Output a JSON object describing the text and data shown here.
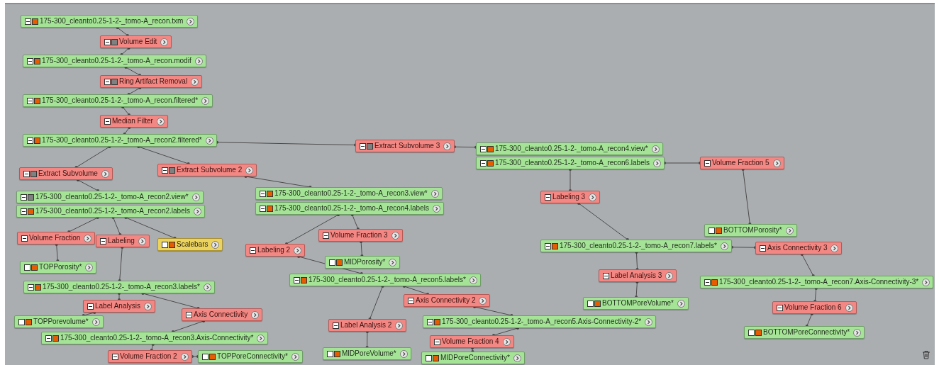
{
  "nodes": [
    {
      "kind": "data",
      "label": "175-300_cleanto0.25-1-2-_tomo-A_recon.txm",
      "expander": true,
      "color": "#e65c00"
    },
    {
      "kind": "module",
      "label": "Volume Edit",
      "expander": true,
      "color": "#808080"
    },
    {
      "kind": "data",
      "label": "175-300_cleanto0.25-1-2-_tomo-A_recon.modif",
      "expander": true,
      "color": "#e65c00"
    },
    {
      "kind": "module",
      "label": "Ring Artifact Removal",
      "expander": true,
      "color": "#808080"
    },
    {
      "kind": "data",
      "label": "175-300_cleanto0.25-1-2-_tomo-A_recon.filtered*",
      "expander": true,
      "color": "#e65c00"
    },
    {
      "kind": "module",
      "label": "Median Filter",
      "expander": true
    },
    {
      "kind": "data",
      "label": "175-300_cleanto0.25-1-2-_tomo-A_recon2.filtered*",
      "expander": true,
      "color": "#e65c00"
    },
    {
      "kind": "module",
      "label": "Extract Subvolume",
      "expander": true,
      "color": "#808080"
    },
    {
      "kind": "module",
      "label": "Extract Subvolume 2",
      "expander": true,
      "color": "#808080"
    },
    {
      "kind": "module",
      "label": "Extract Subvolume 3",
      "expander": true,
      "color": "#808080"
    },
    {
      "kind": "data",
      "label": "175-300_cleanto0.25-1-2-_tomo-A_recon4.view*",
      "expander": true,
      "color": "#e65c00"
    },
    {
      "kind": "data",
      "label": "175-300_cleanto0.25-1-2-_tomo-A_recon6.labels",
      "expander": true,
      "color": "#e65c00"
    },
    {
      "kind": "module",
      "label": "Volume Fraction 5",
      "expander": true
    },
    {
      "kind": "data",
      "label": "175-300_cleanto0.25-1-2-_tomo-A_recon2.view*",
      "expander": true,
      "color": "#808080"
    },
    {
      "kind": "data",
      "label": "175-300_cleanto0.25-1-2-_tomo-A_recon2.labels",
      "expander": true,
      "color": "#e65c00"
    },
    {
      "kind": "module",
      "label": "Labeling 3",
      "expander": true
    },
    {
      "kind": "data",
      "label": "175-300_cleanto0.25-1-2-_tomo-A_recon3.view*",
      "expander": true,
      "color": "#e65c00"
    },
    {
      "kind": "data",
      "label": "175-300_cleanto0.25-1-2-_tomo-A_recon4.labels",
      "expander": true,
      "color": "#e65c00"
    },
    {
      "kind": "module",
      "label": "Volume Fraction",
      "expander": true
    },
    {
      "kind": "module",
      "label": "Labeling",
      "expander": true
    },
    {
      "kind": "display",
      "label": "Scalebars",
      "expander": false,
      "color": "#e65c00"
    },
    {
      "kind": "module",
      "label": "Volume Fraction 3",
      "expander": true
    },
    {
      "kind": "data",
      "label": "BOTTOMPorosity*",
      "expander": false,
      "color": "#e65c00"
    },
    {
      "kind": "module",
      "label": "Labeling 2",
      "expander": true
    },
    {
      "kind": "data",
      "label": "175-300_cleanto0.25-1-2-_tomo-A_recon7.labels*",
      "expander": true,
      "color": "#e65c00"
    },
    {
      "kind": "module",
      "label": "Axis Connectivity 3",
      "expander": true
    },
    {
      "kind": "data",
      "label": "TOPPorosity*",
      "expander": false,
      "color": "#e65c00"
    },
    {
      "kind": "data",
      "label": "MIDPorosity*",
      "expander": false,
      "color": "#e65c00"
    },
    {
      "kind": "module",
      "label": "Label Analysis 3",
      "expander": true
    },
    {
      "kind": "data",
      "label": "175-300_cleanto0.25-1-2-_tomo-A_recon5.labels*",
      "expander": true,
      "color": "#e65c00"
    },
    {
      "kind": "data",
      "label": "175-300_cleanto0.25-1-2-_tomo-A_recon7.Axis-Connectivity-3*",
      "expander": true,
      "color": "#e65c00"
    },
    {
      "kind": "data",
      "label": "175-300_cleanto0.25-1-2-_tomo-A_recon3.labels*",
      "expander": true,
      "color": "#e65c00"
    },
    {
      "kind": "module",
      "label": "Axis Connectivity 2",
      "expander": true
    },
    {
      "kind": "module",
      "label": "Label Analysis",
      "expander": true
    },
    {
      "kind": "data",
      "label": "BOTTOMPoreVolume*",
      "expander": false,
      "color": "#e65c00"
    },
    {
      "kind": "module",
      "label": "Volume Fraction 6",
      "expander": true
    },
    {
      "kind": "module",
      "label": "Axis Connectivity",
      "expander": true
    },
    {
      "kind": "data",
      "label": "TOPPorevolume*",
      "expander": false,
      "color": "#e65c00"
    },
    {
      "kind": "data",
      "label": "175-300_cleanto0.25-1-2-_tomo-A_recon5.Axis-Connectivity-2*",
      "expander": true,
      "color": "#e65c00"
    },
    {
      "kind": "module",
      "label": "Label Analysis 2",
      "expander": true
    },
    {
      "kind": "data",
      "label": "BOTTOMPoreConnectivity*",
      "expander": false,
      "color": "#e65c00"
    },
    {
      "kind": "data",
      "label": "175-300_cleanto0.25-1-2-_tomo-A_recon3.Axis-Connectivity*",
      "expander": true,
      "color": "#e65c00"
    },
    {
      "kind": "module",
      "label": "Volume Fraction 4",
      "expander": true
    },
    {
      "kind": "data",
      "label": "MIDPoreVolume*",
      "expander": false,
      "color": "#e65c00"
    },
    {
      "kind": "module",
      "label": "Volume Fraction 2",
      "expander": true
    },
    {
      "kind": "data",
      "label": "TOPPoreConnectivity*",
      "expander": false,
      "color": "#e65c00"
    },
    {
      "kind": "data",
      "label": "MIDPoreConnectivity*",
      "expander": false,
      "color": "#e65c00"
    }
  ]
}
